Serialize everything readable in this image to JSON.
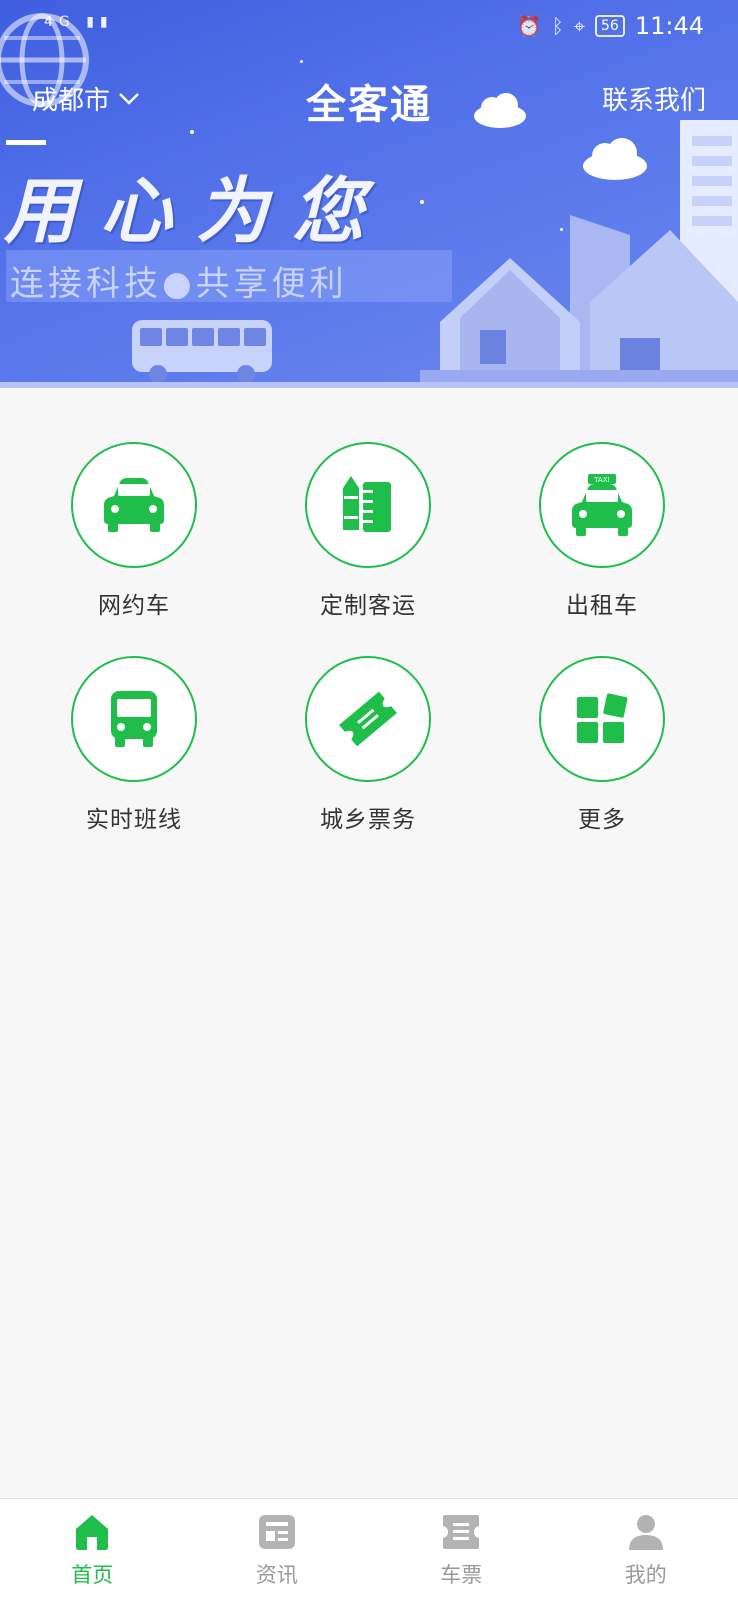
{
  "status_bar": {
    "network": "4G",
    "battery": "56",
    "time": "11:44"
  },
  "header": {
    "city": "成都市",
    "title": "全客通",
    "contact": "联系我们"
  },
  "banner": {
    "slogan_main": "用心为您",
    "slogan_sub": "连接科技●共享便利"
  },
  "services": [
    {
      "label": "网约车",
      "icon": "car-icon"
    },
    {
      "label": "定制客运",
      "icon": "custom-transport-icon"
    },
    {
      "label": "出租车",
      "icon": "taxi-icon"
    },
    {
      "label": "实时班线",
      "icon": "bus-icon"
    },
    {
      "label": "城乡票务",
      "icon": "ticket-icon"
    },
    {
      "label": "更多",
      "icon": "more-apps-icon"
    }
  ],
  "bottom_nav": [
    {
      "label": "首页",
      "icon": "home-icon",
      "active": true
    },
    {
      "label": "资讯",
      "icon": "news-icon",
      "active": false
    },
    {
      "label": "车票",
      "icon": "ticket-nav-icon",
      "active": false
    },
    {
      "label": "我的",
      "icon": "user-icon",
      "active": false
    }
  ],
  "colors": {
    "accent": "#1fbe4a",
    "banner": "#4a68e6",
    "inactive": "#9a9a9a"
  }
}
